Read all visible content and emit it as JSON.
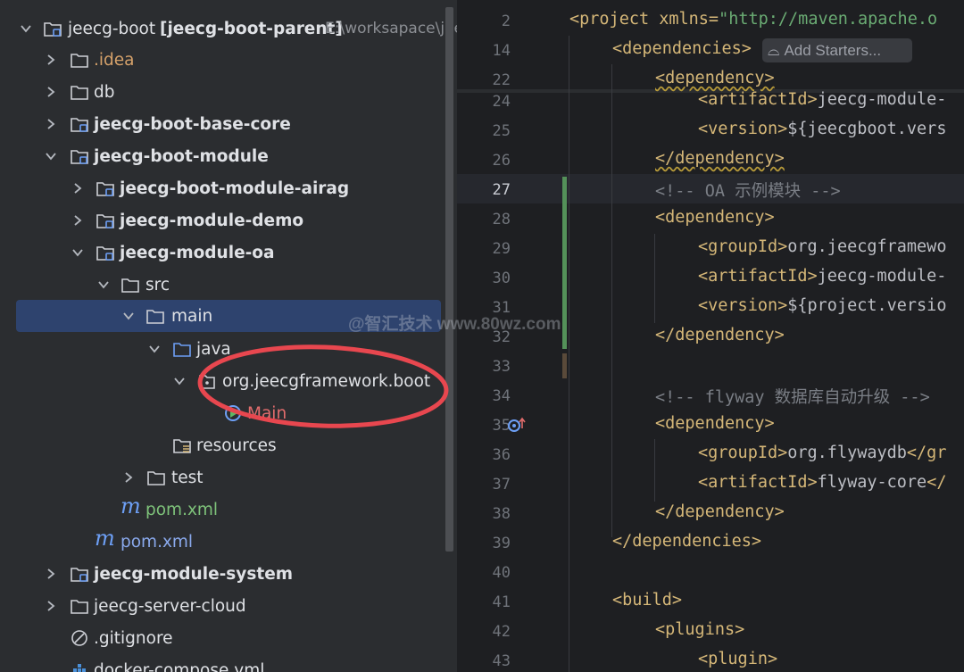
{
  "tree": {
    "root_name": "jeecg-boot",
    "root_module": "[jeecg-boot-parent]",
    "root_path": "E:\\worksapace\\jee",
    "idea": ".idea",
    "db": "db",
    "base_core": "jeecg-boot-base-core",
    "boot_module": "jeecg-boot-module",
    "module_airag": "jeecg-boot-module-airag",
    "module_demo": "jeecg-module-demo",
    "module_oa": "jeecg-module-oa",
    "src": "src",
    "main": "main",
    "java": "java",
    "package": "org.jeecgframework.boot",
    "main_class": "Main",
    "resources": "resources",
    "test": "test",
    "pom_oa": "pom.xml",
    "pom_module": "pom.xml",
    "module_system": "jeecg-module-system",
    "server_cloud": "jeecg-server-cloud",
    "gitignore": ".gitignore",
    "docker_compose": "docker-compose.yml",
    "maven_glyph": "m"
  },
  "editor": {
    "hint": "Add Starters...",
    "watermark": "@智汇技术 www.80wz.com",
    "lines": [
      {
        "n": "2",
        "t1": "<project xmlns=",
        "s": "\"http://maven.apache.o"
      },
      {
        "n": "14",
        "t1": "<dependencies>"
      },
      {
        "n": "22",
        "t1": "<dependency>"
      },
      {
        "n": "24",
        "t1": "<artifactId>",
        "t2": "jeecg-module-"
      },
      {
        "n": "25",
        "t1": "<version>",
        "t2": "${jeecgboot.vers"
      },
      {
        "n": "26",
        "t1": "</dependency>"
      },
      {
        "n": "27",
        "c": "<!-- OA 示例模块 -->"
      },
      {
        "n": "28",
        "t1": "<dependency>"
      },
      {
        "n": "29",
        "t1": "<groupId>",
        "t2": "org.jeecgframewo"
      },
      {
        "n": "30",
        "t1": "<artifactId>",
        "t2": "jeecg-module-"
      },
      {
        "n": "31",
        "t1": "<version>",
        "t2": "${project.versio"
      },
      {
        "n": "32",
        "t1": "</dependency>"
      },
      {
        "n": "33"
      },
      {
        "n": "34",
        "c": "<!-- flyway 数据库自动升级 -->"
      },
      {
        "n": "35",
        "t1": "<dependency>"
      },
      {
        "n": "36",
        "t1": "<groupId>",
        "t2": "org.flywaydb",
        "t3": "</gr"
      },
      {
        "n": "37",
        "t1": "<artifactId>",
        "t2": "flyway-core",
        "t3": "</"
      },
      {
        "n": "38",
        "t1": "</dependency>"
      },
      {
        "n": "39",
        "t1": "</dependencies>"
      },
      {
        "n": "40"
      },
      {
        "n": "41",
        "t1": "<build>"
      },
      {
        "n": "42",
        "t1": "<plugins>"
      },
      {
        "n": "43",
        "t1": "<plugin>"
      }
    ]
  },
  "colors": {
    "selection": "#2e436e",
    "annotation_circle": "#e8474f",
    "tag": "#d5b778",
    "string": "#6aab73"
  }
}
